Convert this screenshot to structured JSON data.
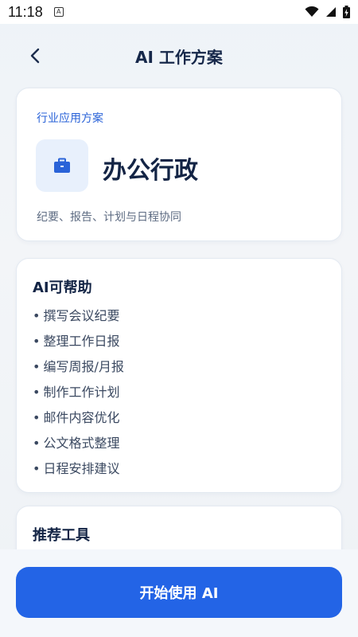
{
  "status_bar": {
    "time": "11:18",
    "notification_letter": "A"
  },
  "header": {
    "title": "AI 工作方案",
    "back_icon": "chevron-left-icon"
  },
  "solution_card": {
    "tag": "行业应用方案",
    "title": "办公行政",
    "description": "纪要、报告、计划与日程协同",
    "icon": "briefcase-icon",
    "accent_color": "#2a63d8",
    "icon_bg_color": "#e8f0fc"
  },
  "help_card": {
    "title": "AI可帮助",
    "bullet": "•",
    "items": [
      "撰写会议纪要",
      "整理工作日报",
      "编写周报/月报",
      "制作工作计划",
      "邮件内容优化",
      "公文格式整理",
      "日程安排建议"
    ]
  },
  "tools_card": {
    "title": "推荐工具"
  },
  "bottom": {
    "start_label": "开始使用 AI",
    "button_color": "#2364e6"
  }
}
